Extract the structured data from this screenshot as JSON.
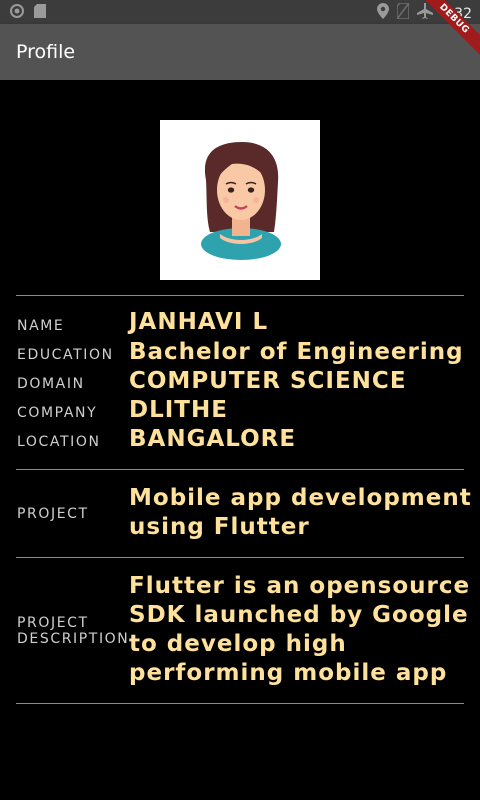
{
  "status_bar": {
    "time": "4:32",
    "icons": [
      "circle-icon",
      "sd-card-icon",
      "location-icon",
      "no-sim-icon",
      "airplane-icon"
    ]
  },
  "app_bar": {
    "title": "Profile"
  },
  "debug_banner": {
    "label": "DEBUG"
  },
  "profile": {
    "name_label": "NAME",
    "name": "JANHAVI L",
    "education_label": "EDUCATION",
    "education": "Bachelor of Engineering",
    "domain_label": "DOMAIN",
    "domain": "COMPUTER SCIENCE",
    "company_label": "COMPANY",
    "company": "DLITHE",
    "location_label": "LOCATION",
    "location": "BANGALORE"
  },
  "project": {
    "label": "PROJECT",
    "line1": "Mobile app development",
    "line2": "using Flutter"
  },
  "project_description": {
    "label1": "PROJECT",
    "label2": "DESCRIPTION",
    "line1": "Flutter is an opensource",
    "line2": "SDK launched by Google",
    "line3": "to develop high",
    "line4": "performing mobile app"
  },
  "colors": {
    "background": "#000000",
    "app_bar": "#535353",
    "value_text": "#ffe19c",
    "label_text": "#cfcfcf"
  }
}
